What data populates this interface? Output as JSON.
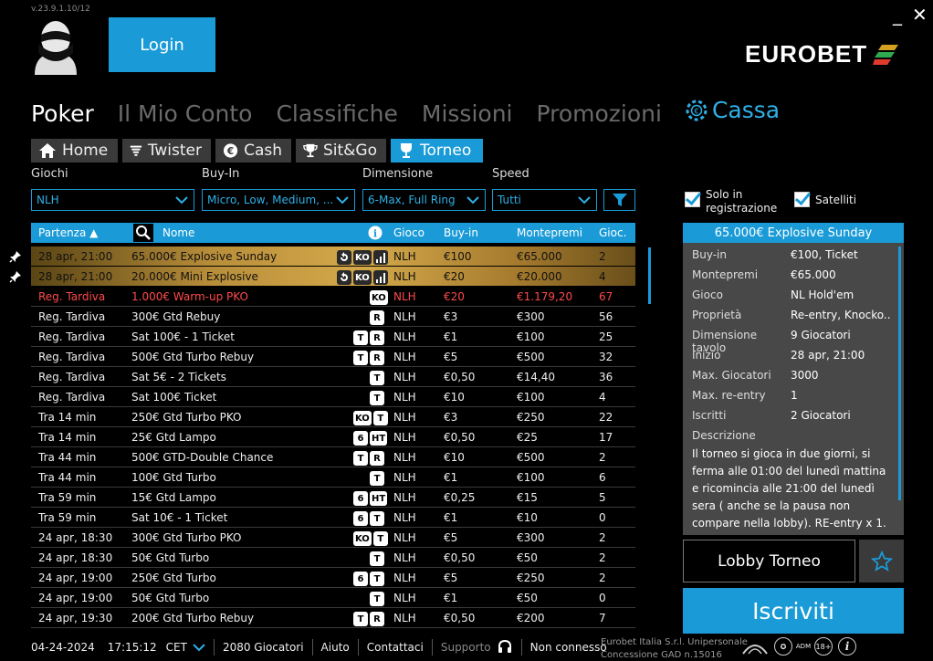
{
  "version": "v.23.9.1.10/12",
  "login_label": "Login",
  "logo_text": "EUROBET",
  "window": {
    "minimize": "_",
    "close": "✕"
  },
  "mainnav": [
    "Poker",
    "Il Mio Conto",
    "Classifiche",
    "Missioni",
    "Promozioni",
    "Cassa"
  ],
  "subtabs": [
    "Home",
    "Twister",
    "Cash",
    "Sit&Go",
    "Torneo"
  ],
  "filters": {
    "giochi": {
      "label": "Giochi",
      "value": "NLH"
    },
    "buyin": {
      "label": "Buy-In",
      "value": "Micro, Low, Medium, ..."
    },
    "dimensione": {
      "label": "Dimensione",
      "value": "6-Max, Full Ring"
    },
    "speed": {
      "label": "Speed",
      "value": "Tutti"
    }
  },
  "checkboxes": {
    "solo_reg": "Solo in registrazione",
    "satelliti": "Satelliti"
  },
  "table": {
    "headers": {
      "partenza": "Partenza ▲",
      "nome": "Nome",
      "gioco": "Gioco",
      "buyin": "Buy-in",
      "montepremi": "Montepremi",
      "gioc": "Gioc."
    },
    "rows": [
      {
        "start": "28 apr, 21:00",
        "name": "65.000€ Explosive Sunday",
        "badges": [
          "R",
          "KO",
          "bars"
        ],
        "game": "NLH",
        "buyin": "€100",
        "prize": "€65.000",
        "players": "2",
        "style": "gold",
        "pin": true
      },
      {
        "start": "28 apr, 21:00",
        "name": "20.000€ Mini Explosive",
        "badges": [
          "R",
          "KO",
          "bars"
        ],
        "game": "NLH",
        "buyin": "€20",
        "prize": "€20.000",
        "players": "4",
        "style": "gold",
        "pin": true
      },
      {
        "start": "Reg. Tardiva",
        "name": "1.000€ Warm-up PKO",
        "badges": [
          "KO"
        ],
        "game": "NLH",
        "buyin": "€20",
        "prize": "€1.179,20",
        "players": "67",
        "style": "late"
      },
      {
        "start": "Reg. Tardiva",
        "name": "300€ Gtd Rebuy",
        "badges": [
          "R"
        ],
        "game": "NLH",
        "buyin": "€3",
        "prize": "€300",
        "players": "56"
      },
      {
        "start": "Reg. Tardiva",
        "name": "Sat 100€ - 1 Ticket",
        "badges": [
          "T",
          "R"
        ],
        "game": "NLH",
        "buyin": "€1",
        "prize": "€100",
        "players": "25"
      },
      {
        "start": "Reg. Tardiva",
        "name": "500€ Gtd Turbo Rebuy",
        "badges": [
          "T",
          "R"
        ],
        "game": "NLH",
        "buyin": "€5",
        "prize": "€500",
        "players": "32"
      },
      {
        "start": "Reg. Tardiva",
        "name": "Sat 5€ - 2 Tickets",
        "badges": [
          "T"
        ],
        "game": "NLH",
        "buyin": "€0,50",
        "prize": "€14,40",
        "players": "36"
      },
      {
        "start": "Reg. Tardiva",
        "name": "Sat 100€ Ticket",
        "badges": [
          "T"
        ],
        "game": "NLH",
        "buyin": "€10",
        "prize": "€100",
        "players": "4"
      },
      {
        "start": "Tra 14 min",
        "name": "250€ Gtd Turbo PKO",
        "badges": [
          "KO",
          "T"
        ],
        "game": "NLH",
        "buyin": "€3",
        "prize": "€250",
        "players": "22"
      },
      {
        "start": "Tra 14 min",
        "name": "25€ Gtd Lampo",
        "badges": [
          "6",
          "HT"
        ],
        "game": "NLH",
        "buyin": "€0,50",
        "prize": "€25",
        "players": "17"
      },
      {
        "start": "Tra 44 min",
        "name": "500€ GTD-Double Chance",
        "badges": [
          "T",
          "R"
        ],
        "game": "NLH",
        "buyin": "€10",
        "prize": "€500",
        "players": "2"
      },
      {
        "start": "Tra 44 min",
        "name": "100€ Gtd Turbo",
        "badges": [
          "T"
        ],
        "game": "NLH",
        "buyin": "€1",
        "prize": "€100",
        "players": "6"
      },
      {
        "start": "Tra 59 min",
        "name": "15€ Gtd Lampo",
        "badges": [
          "6",
          "HT"
        ],
        "game": "NLH",
        "buyin": "€0,25",
        "prize": "€15",
        "players": "5"
      },
      {
        "start": "Tra 59 min",
        "name": "Sat 10€ - 1 Ticket",
        "badges": [
          "6",
          "T"
        ],
        "game": "NLH",
        "buyin": "€1",
        "prize": "€10",
        "players": "0"
      },
      {
        "start": "24 apr, 18:30",
        "name": "300€ Gtd Turbo PKO",
        "badges": [
          "KO",
          "T"
        ],
        "game": "NLH",
        "buyin": "€5",
        "prize": "€300",
        "players": "2"
      },
      {
        "start": "24 apr, 18:30",
        "name": "50€ Gtd Turbo",
        "badges": [
          "T"
        ],
        "game": "NLH",
        "buyin": "€0,50",
        "prize": "€50",
        "players": "2"
      },
      {
        "start": "24 apr, 19:00",
        "name": "250€ Gtd Turbo",
        "badges": [
          "6",
          "T"
        ],
        "game": "NLH",
        "buyin": "€5",
        "prize": "€250",
        "players": "2"
      },
      {
        "start": "24 apr, 19:00",
        "name": "50€ Gtd Turbo",
        "badges": [
          "T"
        ],
        "game": "NLH",
        "buyin": "€1",
        "prize": "€50",
        "players": "0"
      },
      {
        "start": "24 apr, 19:30",
        "name": "200€ Gtd Turbo Rebuy",
        "badges": [
          "T",
          "R"
        ],
        "game": "NLH",
        "buyin": "€0,50",
        "prize": "€200",
        "players": "7"
      }
    ]
  },
  "panel": {
    "title": "65.000€ Explosive Sunday",
    "details": [
      {
        "k": "Buy-in",
        "v": "€100, Ticket"
      },
      {
        "k": "Montepremi",
        "v": "€65.000"
      },
      {
        "k": "Gioco",
        "v": "NL Hold'em"
      },
      {
        "k": "Proprietà",
        "v": "Re-entry, Knocko..."
      },
      {
        "k": "Dimensione tavolo",
        "v": "9 Giocatori"
      },
      {
        "k": "Inizio",
        "v": "28 apr, 21:00"
      },
      {
        "k": "Max. Giocatori",
        "v": "3000"
      },
      {
        "k": "Max. re-entry",
        "v": "1"
      },
      {
        "k": "Iscritti",
        "v": "2 Giocatori"
      }
    ],
    "desc_label": "Descrizione",
    "description": "Il torneo si gioca in due giorni, si ferma alle 01:00 del lunedì mattina e ricomincia alle 21:00 del lunedì sera ( anche se la pausa non compare nella lobby). RE-entry x 1.",
    "lobby_label": "Lobby Torneo",
    "register_label": "Iscriviti"
  },
  "footer": {
    "date": "04-24-2024",
    "time": "17:15:12",
    "tz": "CET",
    "players": "2080 Giocatori",
    "help": "Aiuto",
    "contacts": "Contattaci",
    "support": "Supporto",
    "status": "Non connesso",
    "legal1": "Eurobet Italia S.r.l. Unipersonale",
    "legal2": "Concessione GAD n.15016"
  },
  "colors": {
    "accent": "#1a9bd7",
    "late": "#ff4a4a",
    "gold": "#d4a94a"
  }
}
